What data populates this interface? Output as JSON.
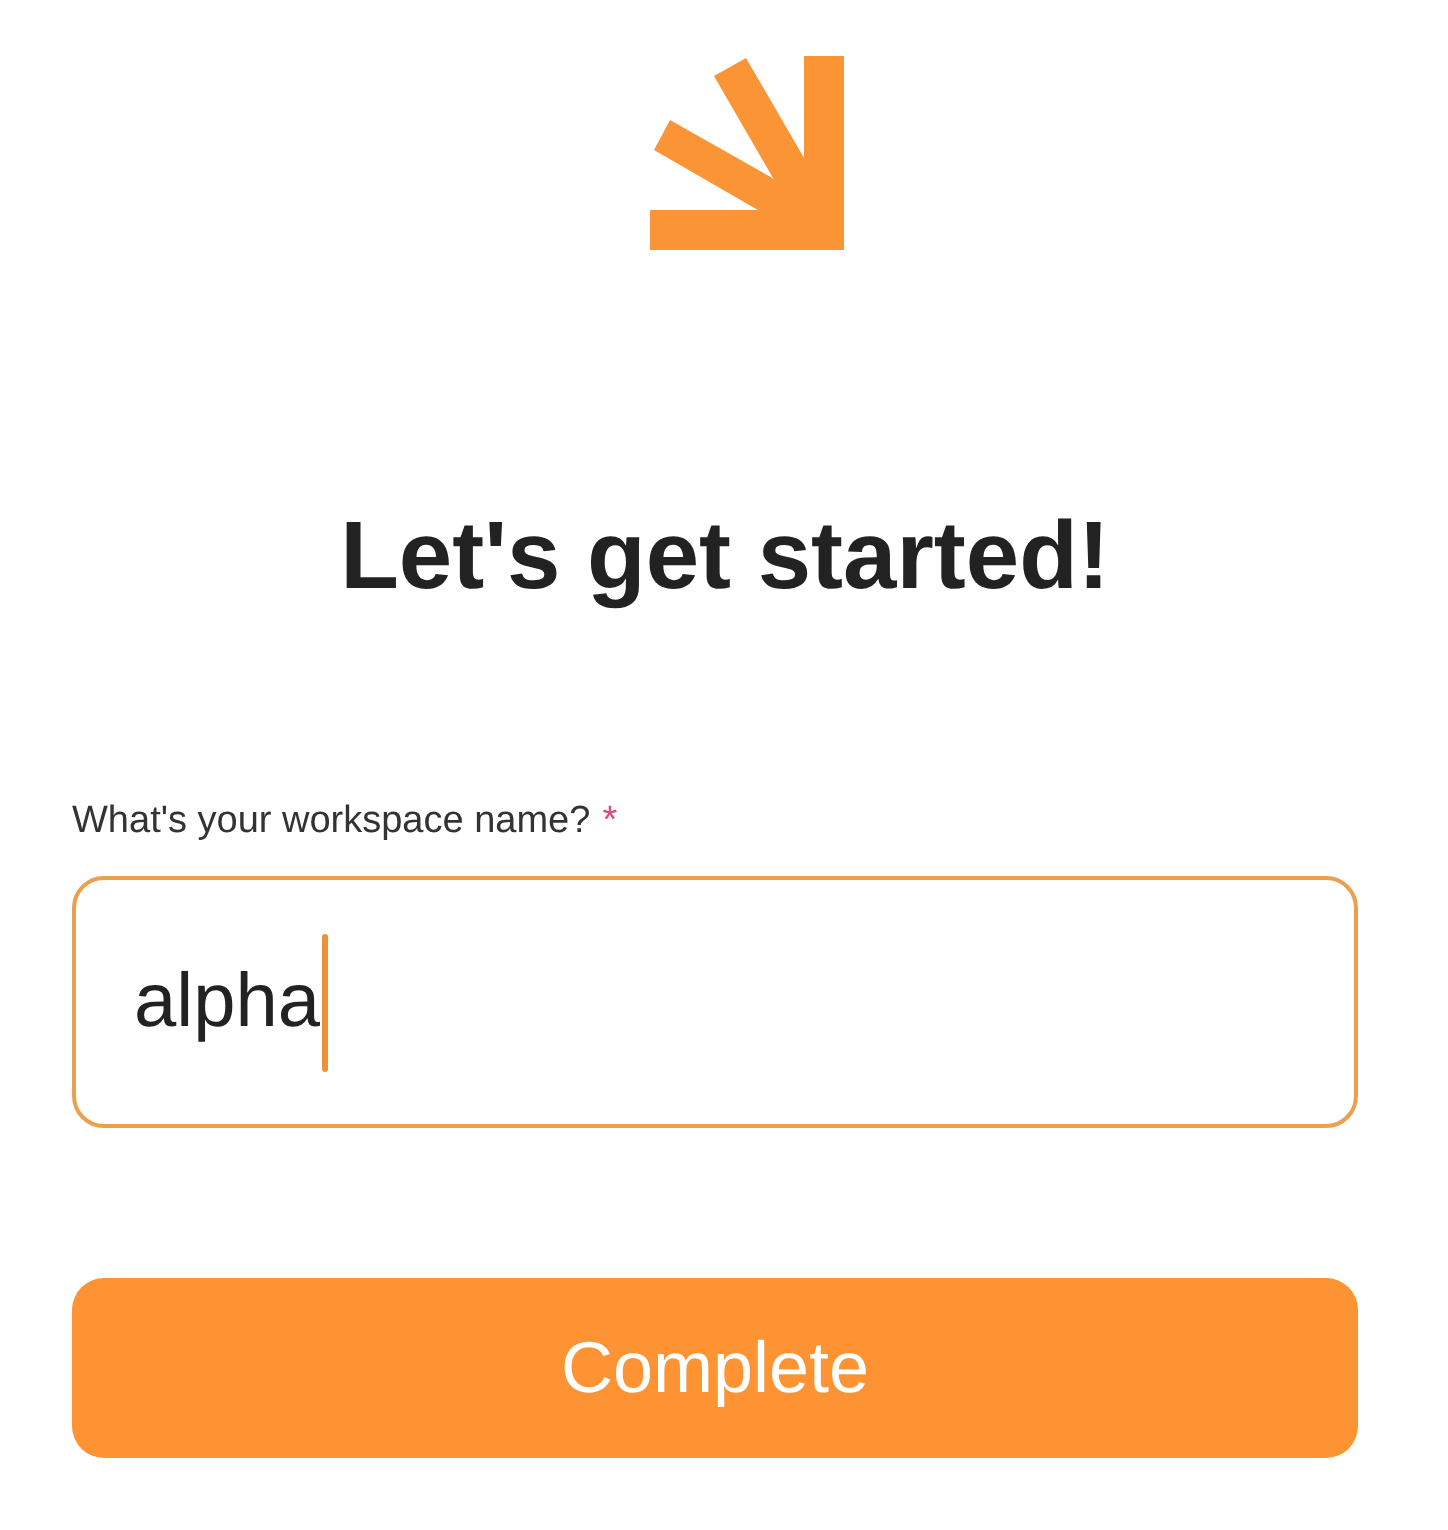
{
  "heading": "Let's get started!",
  "field": {
    "label": "What's your workspace name?",
    "required_mark": "*",
    "value": "alpha",
    "focused": true
  },
  "button": {
    "label": "Complete"
  }
}
